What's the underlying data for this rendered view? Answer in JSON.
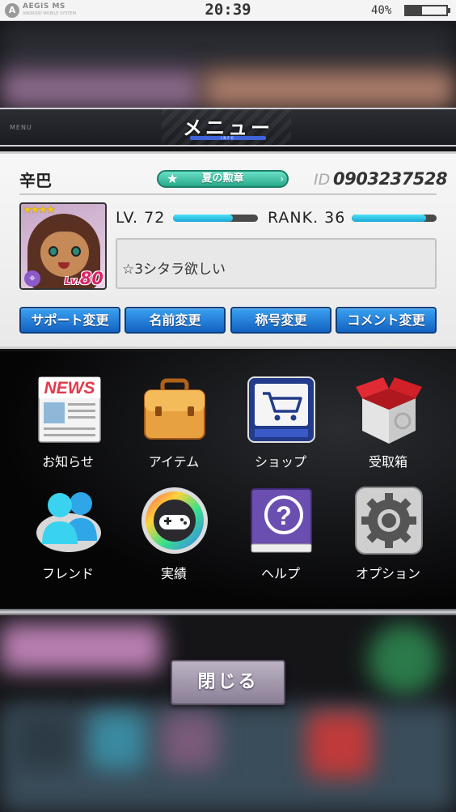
{
  "status_bar": {
    "brand": "AEGIS MS",
    "brand_sub": "ANDROID MOBILE SYSTEM",
    "time": "20:39",
    "battery_text": "40%",
    "battery_level": 0.4
  },
  "menu_header": {
    "small_label": "MENU",
    "title": "メニュー",
    "subtitle": "INFO"
  },
  "profile": {
    "name": "辛巴",
    "title_badge": "夏の勲章",
    "id_label": "ID",
    "id_value": "0903237528",
    "card_stars": "★★★★",
    "card_level_prefix": "Lv.",
    "card_level": "80",
    "level_label": "LV. 72",
    "level_progress": 0.7,
    "rank_label": "RANK. 36",
    "rank_progress": 0.88,
    "comment": "☆3シタラ欲しい"
  },
  "actions": [
    {
      "label": "サポート変更"
    },
    {
      "label": "名前変更"
    },
    {
      "label": "称号変更"
    },
    {
      "label": "コメント変更"
    }
  ],
  "grid": [
    {
      "label": "お知らせ",
      "icon": "news-icon",
      "icon_text": "NEWS"
    },
    {
      "label": "アイテム",
      "icon": "briefcase-icon"
    },
    {
      "label": "ショップ",
      "icon": "shopping-cart-icon"
    },
    {
      "label": "受取箱",
      "icon": "gift-box-icon"
    },
    {
      "label": "フレンド",
      "icon": "friends-icon"
    },
    {
      "label": "実績",
      "icon": "gamepad-icon"
    },
    {
      "label": "ヘルプ",
      "icon": "help-book-icon",
      "icon_text": "?"
    },
    {
      "label": "オプション",
      "icon": "gear-icon"
    }
  ],
  "close_label": "閉じる",
  "colors": {
    "action_button": "#1a78d8",
    "title_badge": "#2fb897",
    "gauge": "#2cc3e8",
    "card_level": "#e0226a"
  }
}
